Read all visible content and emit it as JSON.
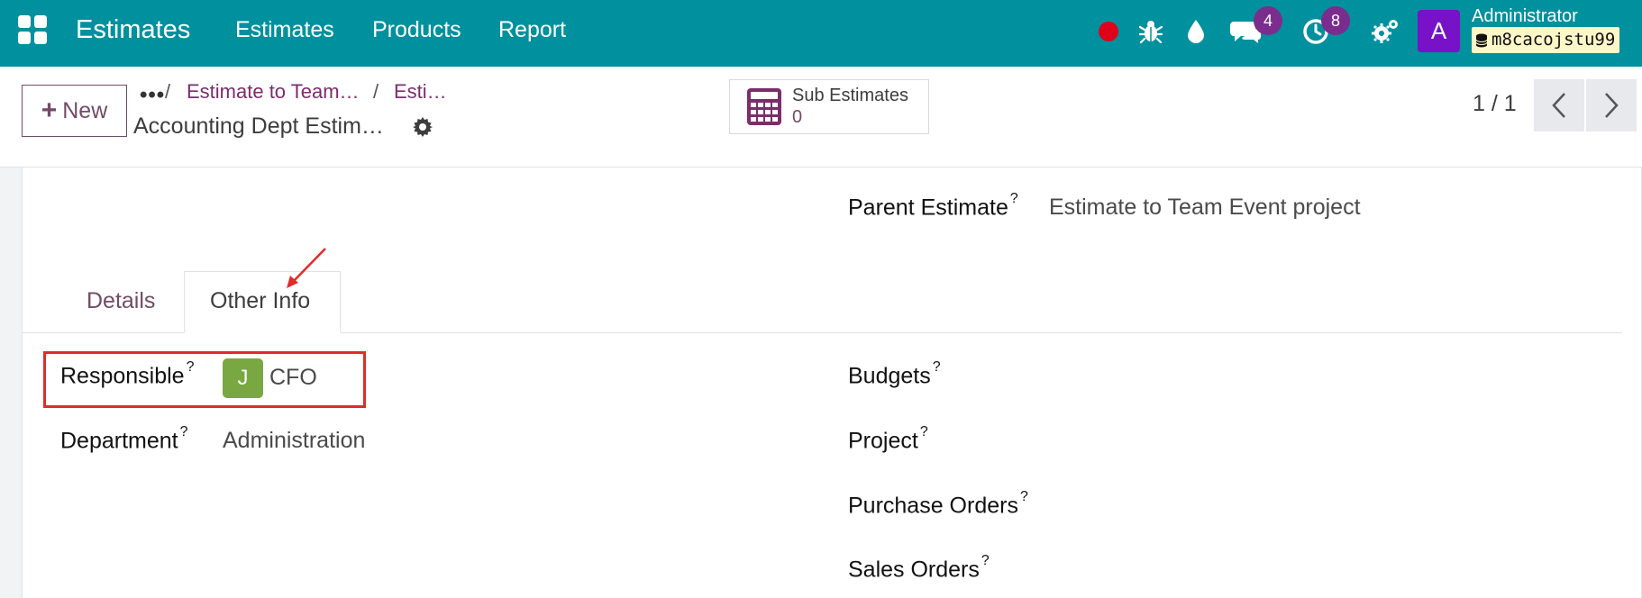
{
  "navbar": {
    "brand": "Estimates",
    "menu": [
      "Estimates",
      "Products",
      "Report"
    ],
    "icons": [
      "apps-grid-icon",
      "record-icon",
      "bug-icon",
      "droplet-icon",
      "chat-icon",
      "clock-icon",
      "settings-icon"
    ],
    "chat_badge": "4",
    "activity_badge": "8",
    "avatar_letter": "A",
    "user_name": "Administrator",
    "database": "m8cacojstu99",
    "color": "#01909d"
  },
  "control": {
    "new_label": "New",
    "breadcrumb_dots": "•••",
    "breadcrumb_sep": "/",
    "breadcrumb": [
      "Estimate to Team…",
      "Esti…"
    ],
    "record_title": "Accounting Dept Estim…",
    "smart_button": {
      "label": "Sub Estimates",
      "value": "0"
    },
    "pager": "1 / 1"
  },
  "form": {
    "parent_estimate_label": "Parent Estimate",
    "parent_estimate_value": "Estimate to Team Event project",
    "help_mark": "?",
    "tabs": [
      "Details",
      "Other Info"
    ],
    "active_tab": "Other Info",
    "left_fields": [
      {
        "label": "Responsible",
        "value": "CFO",
        "avatar": "J"
      },
      {
        "label": "Department",
        "value": "Administration"
      }
    ],
    "right_fields": [
      {
        "label": "Budgets"
      },
      {
        "label": "Project"
      },
      {
        "label": "Purchase Orders"
      },
      {
        "label": "Sales Orders"
      }
    ]
  },
  "colors": {
    "accent": "#714b67",
    "highlight": "#e02b2b",
    "avatar_j": "#79a842",
    "avatar_a": "#7712c9"
  }
}
